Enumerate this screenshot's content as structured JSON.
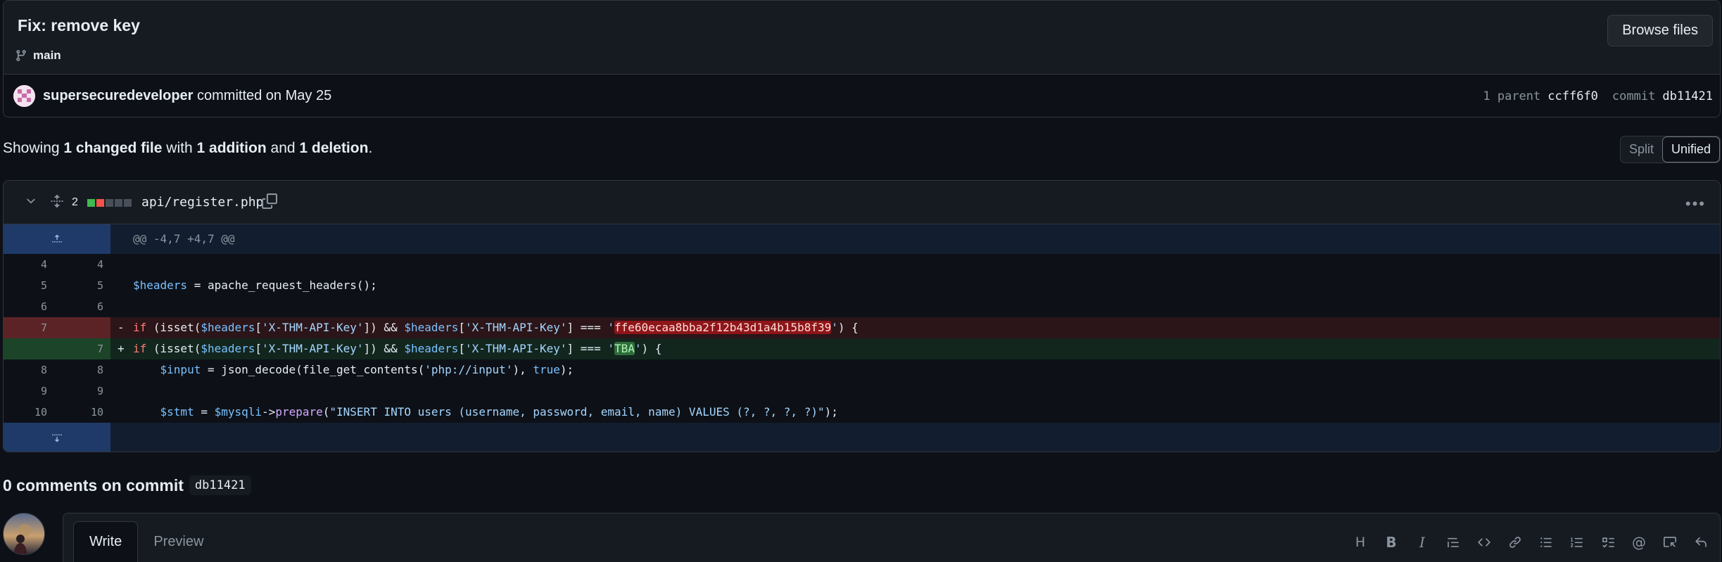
{
  "commit": {
    "title": "Fix: remove key",
    "branch": "main",
    "browse_label": "Browse files",
    "author": "supersecuredeveloper",
    "committed_text": "committed on May 25",
    "parent_label": "1 parent",
    "parent_sha": "ccff6f0",
    "commit_label": "commit",
    "commit_sha": "db11421"
  },
  "summary": {
    "showing": "Showing",
    "files": "1 changed file",
    "with": "with",
    "additions": "1 addition",
    "and": "and",
    "deletions": "1 deletion",
    "end": ".",
    "split_label": "Split",
    "unified_label": "Unified"
  },
  "file": {
    "change_count": "2",
    "name": "api/register.php",
    "hunk_header": "@@ -4,7 +4,7 @@"
  },
  "lines": [
    {
      "old": "4",
      "new": "4",
      "type": "ctx"
    },
    {
      "old": "5",
      "new": "5",
      "type": "ctx"
    },
    {
      "old": "6",
      "new": "6",
      "type": "ctx"
    },
    {
      "old": "7",
      "new": "",
      "type": "del",
      "mark": "-"
    },
    {
      "old": "",
      "new": "7",
      "type": "add",
      "mark": "+"
    },
    {
      "old": "8",
      "new": "8",
      "type": "ctx"
    },
    {
      "old": "9",
      "new": "9",
      "type": "ctx"
    },
    {
      "old": "10",
      "new": "10",
      "type": "ctx"
    }
  ],
  "code": {
    "l5_var": "$headers",
    "l5_rest": " = apache_request_headers();",
    "l7_if": "if",
    "l7_a": " (isset(",
    "l7_var1": "$headers",
    "l7_b": "[",
    "l7_key1": "'X-THM-API-Key'",
    "l7_c": "]) && ",
    "l7_var2": "$headers",
    "l7_d": "[",
    "l7_key2": "'X-THM-API-Key'",
    "l7_e": "] === ",
    "l7_q1": "'",
    "l7_old_key": "ffe60ecaa8bba2f12b43d1a4b15b8f39",
    "l7_q2": "'",
    "l7_f": ") {",
    "add_new_key": "TBA",
    "l8_indent": "    ",
    "l8_var": "$input",
    "l8_a": " = json_decode(file_get_contents(",
    "l8_str": "'php://input'",
    "l8_b": "), ",
    "l8_true": "true",
    "l8_c": ");",
    "l10_indent": "    ",
    "l10_var1": "$stmt",
    "l10_a": " = ",
    "l10_var2": "$mysqli",
    "l10_b": "->",
    "l10_fn": "prepare",
    "l10_c": "(",
    "l10_str": "\"INSERT INTO users (username, password, email, name) VALUES (?, ?, ?, ?)\"",
    "l10_d": ");"
  },
  "comments": {
    "title": "0 comments on commit",
    "sha": "db11421",
    "write_tab": "Write",
    "preview_tab": "Preview",
    "toolbar": [
      "heading-icon",
      "bold-icon",
      "italic-icon",
      "quote-icon",
      "code-icon",
      "link-icon",
      "unordered-list-icon",
      "ordered-list-icon",
      "task-list-icon",
      "mention-icon",
      "reference-icon",
      "reply-icon"
    ]
  },
  "colors": {
    "bg": "#0d1117",
    "deleted_line": "#5c2326",
    "added_line": "#1c4428",
    "hunk_gutter": "#1f3a68",
    "diffstat_add": "#3fb950",
    "diffstat_del": "#f85149"
  }
}
